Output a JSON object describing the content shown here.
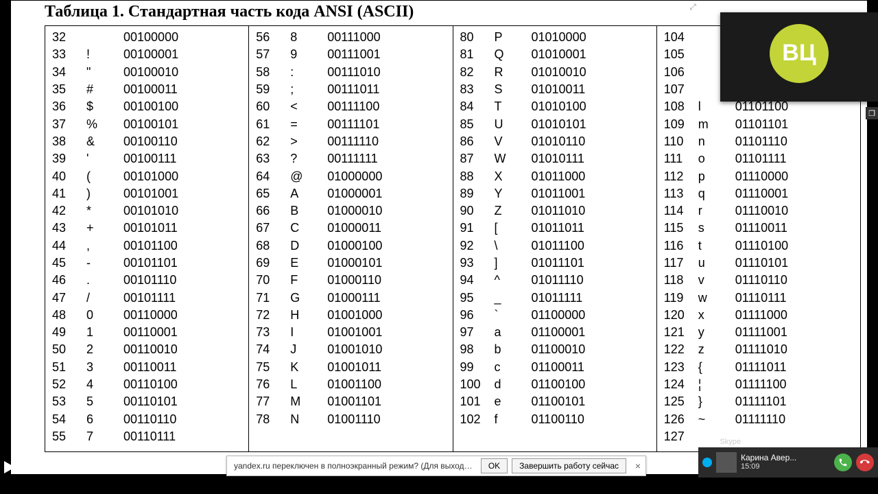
{
  "title": "Таблица 1. Стандартная часть кода ANSI (ASCII)",
  "notification": {
    "message": "yandex.ru переключен в полноэкранный режим? (Для выхода нажмите ESC.)",
    "ok": "OK",
    "end": "Завершить работу сейчас",
    "close": "×"
  },
  "call": {
    "initials": "ВЦ",
    "pop_icon": "❐"
  },
  "skype_toast": {
    "app": "Skype",
    "name": "Карина Авер...",
    "time": "15:09"
  },
  "expand_icon": "⤢",
  "columns": [
    [
      {
        "dec": "32",
        "chr": "",
        "bin": "00100000"
      },
      {
        "dec": "33",
        "chr": "!",
        "bin": "00100001"
      },
      {
        "dec": "34",
        "chr": "\"",
        "bin": "00100010"
      },
      {
        "dec": "35",
        "chr": "#",
        "bin": "00100011"
      },
      {
        "dec": "36",
        "chr": "$",
        "bin": "00100100"
      },
      {
        "dec": "37",
        "chr": "%",
        "bin": "00100101"
      },
      {
        "dec": "38",
        "chr": "&",
        "bin": "00100110"
      },
      {
        "dec": "39",
        "chr": "'",
        "bin": "00100111"
      },
      {
        "dec": "40",
        "chr": "(",
        "bin": "00101000"
      },
      {
        "dec": "41",
        "chr": ")",
        "bin": "00101001"
      },
      {
        "dec": "42",
        "chr": "*",
        "bin": "00101010"
      },
      {
        "dec": "43",
        "chr": "+",
        "bin": "00101011"
      },
      {
        "dec": "44",
        "chr": ",",
        "bin": "00101100"
      },
      {
        "dec": "45",
        "chr": "-",
        "bin": "00101101"
      },
      {
        "dec": "46",
        "chr": ".",
        "bin": "00101110"
      },
      {
        "dec": "47",
        "chr": "/",
        "bin": "00101111"
      },
      {
        "dec": "48",
        "chr": "0",
        "bin": "00110000"
      },
      {
        "dec": "49",
        "chr": "1",
        "bin": "00110001"
      },
      {
        "dec": "50",
        "chr": "2",
        "bin": "00110010"
      },
      {
        "dec": "51",
        "chr": "3",
        "bin": "00110011"
      },
      {
        "dec": "52",
        "chr": "4",
        "bin": "00110100"
      },
      {
        "dec": "53",
        "chr": "5",
        "bin": "00110101"
      },
      {
        "dec": "54",
        "chr": "6",
        "bin": "00110110"
      },
      {
        "dec": "55",
        "chr": "7",
        "bin": "00110111"
      }
    ],
    [
      {
        "dec": "56",
        "chr": "8",
        "bin": "00111000"
      },
      {
        "dec": "57",
        "chr": "9",
        "bin": "00111001"
      },
      {
        "dec": "58",
        "chr": ":",
        "bin": "00111010"
      },
      {
        "dec": "59",
        "chr": ";",
        "bin": "00111011"
      },
      {
        "dec": "60",
        "chr": "<",
        "bin": "00111100"
      },
      {
        "dec": "61",
        "chr": "=",
        "bin": "00111101"
      },
      {
        "dec": "62",
        "chr": ">",
        "bin": "00111110"
      },
      {
        "dec": "63",
        "chr": "?",
        "bin": "00111111"
      },
      {
        "dec": "64",
        "chr": "@",
        "bin": "01000000"
      },
      {
        "dec": "65",
        "chr": "A",
        "bin": "01000001"
      },
      {
        "dec": "66",
        "chr": "B",
        "bin": "01000010"
      },
      {
        "dec": "67",
        "chr": "C",
        "bin": "01000011"
      },
      {
        "dec": "68",
        "chr": "D",
        "bin": "01000100"
      },
      {
        "dec": "69",
        "chr": "E",
        "bin": "01000101"
      },
      {
        "dec": "70",
        "chr": "F",
        "bin": "01000110"
      },
      {
        "dec": "71",
        "chr": "G",
        "bin": "01000111"
      },
      {
        "dec": "72",
        "chr": "H",
        "bin": "01001000"
      },
      {
        "dec": "73",
        "chr": "I",
        "bin": "01001001"
      },
      {
        "dec": "74",
        "chr": "J",
        "bin": "01001010"
      },
      {
        "dec": "75",
        "chr": "K",
        "bin": "01001011"
      },
      {
        "dec": "76",
        "chr": "L",
        "bin": "01001100"
      },
      {
        "dec": "77",
        "chr": "M",
        "bin": "01001101"
      },
      {
        "dec": "78",
        "chr": "N",
        "bin": "01001110"
      },
      {
        "dec": "",
        "chr": "",
        "bin": ""
      }
    ],
    [
      {
        "dec": "80",
        "chr": "P",
        "bin": "01010000"
      },
      {
        "dec": "81",
        "chr": "Q",
        "bin": "01010001"
      },
      {
        "dec": "82",
        "chr": "R",
        "bin": "01010010"
      },
      {
        "dec": "83",
        "chr": "S",
        "bin": "01010011"
      },
      {
        "dec": "84",
        "chr": "T",
        "bin": "01010100"
      },
      {
        "dec": "85",
        "chr": "U",
        "bin": "01010101"
      },
      {
        "dec": "86",
        "chr": "V",
        "bin": "01010110"
      },
      {
        "dec": "87",
        "chr": "W",
        "bin": "01010111"
      },
      {
        "dec": "88",
        "chr": "X",
        "bin": "01011000"
      },
      {
        "dec": "89",
        "chr": "Y",
        "bin": "01011001"
      },
      {
        "dec": "90",
        "chr": "Z",
        "bin": "01011010"
      },
      {
        "dec": "91",
        "chr": "[",
        "bin": "01011011"
      },
      {
        "dec": "92",
        "chr": "\\",
        "bin": "01011100"
      },
      {
        "dec": "93",
        "chr": "]",
        "bin": "01011101"
      },
      {
        "dec": "94",
        "chr": "^",
        "bin": "01011110"
      },
      {
        "dec": "95",
        "chr": "_",
        "bin": "01011111"
      },
      {
        "dec": "96",
        "chr": "`",
        "bin": "01100000"
      },
      {
        "dec": "97",
        "chr": "a",
        "bin": "01100001"
      },
      {
        "dec": "98",
        "chr": "b",
        "bin": "01100010"
      },
      {
        "dec": "99",
        "chr": "c",
        "bin": "01100011"
      },
      {
        "dec": "100",
        "chr": "d",
        "bin": "01100100"
      },
      {
        "dec": "101",
        "chr": "e",
        "bin": "01100101"
      },
      {
        "dec": "102",
        "chr": "f",
        "bin": "01100110"
      },
      {
        "dec": "",
        "chr": "",
        "bin": ""
      }
    ],
    [
      {
        "dec": "104",
        "chr": "",
        "bin": ""
      },
      {
        "dec": "105",
        "chr": "",
        "bin": ""
      },
      {
        "dec": "106",
        "chr": "",
        "bin": ""
      },
      {
        "dec": "107",
        "chr": "",
        "bin": ""
      },
      {
        "dec": "108",
        "chr": "l",
        "bin": "01101100"
      },
      {
        "dec": "109",
        "chr": "m",
        "bin": "01101101"
      },
      {
        "dec": "110",
        "chr": "n",
        "bin": "01101110"
      },
      {
        "dec": "111",
        "chr": "o",
        "bin": "01101111"
      },
      {
        "dec": "112",
        "chr": "p",
        "bin": "01110000"
      },
      {
        "dec": "113",
        "chr": "q",
        "bin": "01110001"
      },
      {
        "dec": "114",
        "chr": "r",
        "bin": "01110010"
      },
      {
        "dec": "115",
        "chr": "s",
        "bin": "01110011"
      },
      {
        "dec": "116",
        "chr": "t",
        "bin": "01110100"
      },
      {
        "dec": "117",
        "chr": "u",
        "bin": "01110101"
      },
      {
        "dec": "118",
        "chr": "v",
        "bin": "01110110"
      },
      {
        "dec": "119",
        "chr": "w",
        "bin": "01110111"
      },
      {
        "dec": "120",
        "chr": "x",
        "bin": "01111000"
      },
      {
        "dec": "121",
        "chr": "y",
        "bin": "01111001"
      },
      {
        "dec": "122",
        "chr": "z",
        "bin": "01111010"
      },
      {
        "dec": "123",
        "chr": "{",
        "bin": "01111011"
      },
      {
        "dec": "124",
        "chr": "¦",
        "bin": "01111100"
      },
      {
        "dec": "125",
        "chr": "}",
        "bin": "01111101"
      },
      {
        "dec": "126",
        "chr": "~",
        "bin": "01111110"
      },
      {
        "dec": "127",
        "chr": "",
        "bin": ""
      }
    ]
  ]
}
